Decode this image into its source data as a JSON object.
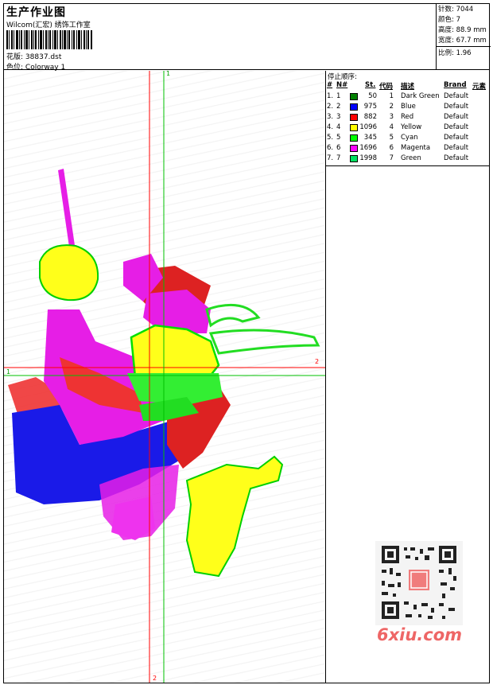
{
  "header": {
    "title": "生产作业图",
    "company": "Wilcom(汇宏) 绣饰工作室",
    "design_label": "花版:",
    "design_file": "38837.dst",
    "colorway_label": "色位:",
    "colorway": "Colorway 1"
  },
  "stats": {
    "stitches_label": "针数:",
    "stitches": "7044",
    "colors_label": "颜色:",
    "colors": "7",
    "height_label": "高度:",
    "height": "88.9 mm",
    "width_label": "宽度:",
    "width": "67.7 mm",
    "scale_label": "比例:",
    "scale": "1.96"
  },
  "axes": {
    "v_top": "1",
    "v_bottom": "2",
    "h_left": "1",
    "h_right": "2"
  },
  "stop_sequence": {
    "title": "停止顺序:",
    "headers": [
      "#",
      "N#",
      "St.",
      "代码",
      "描述",
      "Brand",
      "元素"
    ],
    "rows": [
      {
        "n": "1.",
        "nn": "1",
        "color": "#008000",
        "st": "50",
        "code": "1",
        "desc": "Dark Green",
        "brand": "Default"
      },
      {
        "n": "2.",
        "nn": "2",
        "color": "#0000ff",
        "st": "975",
        "code": "2",
        "desc": "Blue",
        "brand": "Default"
      },
      {
        "n": "3.",
        "nn": "3",
        "color": "#ff0000",
        "st": "882",
        "code": "3",
        "desc": "Red",
        "brand": "Default"
      },
      {
        "n": "4.",
        "nn": "4",
        "color": "#ffff00",
        "st": "1096",
        "code": "4",
        "desc": "Yellow",
        "brand": "Default"
      },
      {
        "n": "5.",
        "nn": "5",
        "color": "#00ff00",
        "st": "345",
        "code": "5",
        "desc": "Cyan",
        "brand": "Default"
      },
      {
        "n": "6.",
        "nn": "6",
        "color": "#ff00ff",
        "st": "1696",
        "code": "6",
        "desc": "Magenta",
        "brand": "Default"
      },
      {
        "n": "7.",
        "nn": "7",
        "color": "#00e060",
        "st": "1998",
        "code": "7",
        "desc": "Green",
        "brand": "Default"
      }
    ]
  },
  "watermark": {
    "text": "6xiu.com"
  },
  "colors": {
    "axis_red": "#ff0000",
    "axis_green": "#00c000"
  }
}
